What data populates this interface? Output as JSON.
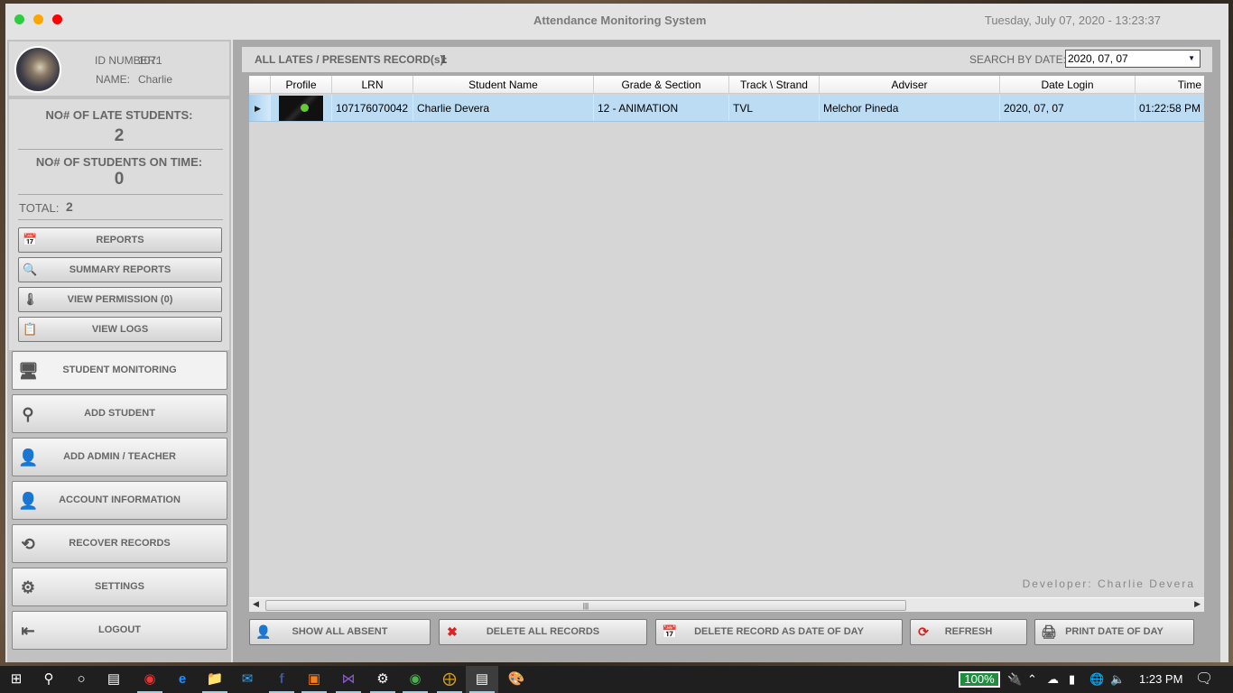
{
  "window": {
    "title": "Attendance Monitoring System",
    "datetime": "Tuesday, July  07, 2020 - 13:23:37",
    "controls": [
      {
        "name": "maximize",
        "color": "#2ecc40"
      },
      {
        "name": "minimize",
        "color": "#ffa500"
      },
      {
        "name": "close",
        "color": "#ff0000"
      }
    ]
  },
  "profile": {
    "id_label": "ID NUMBER:",
    "id_value": "1071",
    "name_label": "NAME:",
    "name_value": "Charlie"
  },
  "stats": {
    "late_label": "NO# OF LATE STUDENTS:",
    "late_value": "2",
    "ontime_label": "NO# OF STUDENTS ON TIME:",
    "ontime_value": "0",
    "total_label": "TOTAL:",
    "total_value": "2"
  },
  "side_buttons": [
    {
      "label": "REPORTS",
      "icon": "calendar-icon"
    },
    {
      "label": "SUMMARY REPORTS",
      "icon": "magnifier-chart-icon"
    },
    {
      "label": "VIEW PERMISSION (0)",
      "icon": "thermometer-icon"
    },
    {
      "label": "VIEW LOGS",
      "icon": "clipboard-icon"
    }
  ],
  "nav": [
    {
      "label": "STUDENT MONITORING",
      "icon": "monitor-icon",
      "active": true
    },
    {
      "label": "ADD STUDENT",
      "icon": "user-add-icon"
    },
    {
      "label": "ADD ADMIN / TEACHER",
      "icon": "user-icon"
    },
    {
      "label": "ACCOUNT INFORMATION",
      "icon": "user-info-icon"
    },
    {
      "label": "RECOVER RECORDS",
      "icon": "recover-icon"
    },
    {
      "label": "SETTINGS",
      "icon": "gear-icon"
    },
    {
      "label": "LOGOUT",
      "icon": "logout-icon"
    }
  ],
  "main": {
    "records_label": "ALL LATES / PRESENTS RECORD(s):",
    "records_count": "1",
    "search_label": "SEARCH BY DATE:",
    "search_value": "2020, 07, 07",
    "developer": "Developer: Charlie Devera"
  },
  "table": {
    "columns": [
      "Profile",
      "LRN",
      "Student Name",
      "Grade & Section",
      "Track \\ Strand",
      "Adviser",
      "Date Login",
      "Time"
    ],
    "rows": [
      {
        "profile": "android-thumbnail",
        "lrn": "107176070042",
        "name": "Charlie Devera",
        "grade": "12 - ANIMATION",
        "track": "TVL",
        "adviser": "Melchor Pineda",
        "date": "2020, 07, 07",
        "time": "01:22:58 PM"
      }
    ]
  },
  "bottom_buttons": [
    {
      "label": "SHOW ALL ABSENT",
      "icon": "user-clock-icon"
    },
    {
      "label": "DELETE ALL RECORDS",
      "icon": "delete-x-icon"
    },
    {
      "label": "DELETE RECORD AS DATE OF DAY",
      "icon": "calendar-delete-icon"
    },
    {
      "label": "REFRESH",
      "icon": "refresh-icon"
    },
    {
      "label": "PRINT DATE OF DAY",
      "icon": "printer-icon"
    }
  ],
  "taskbar": {
    "apps": [
      "start",
      "search",
      "cortana",
      "task-view",
      "vivaldi",
      "edge",
      "file-explorer",
      "mail",
      "facebook",
      "xampp",
      "visual-studio",
      "settings",
      "chrome",
      "target-app",
      "attendance-app",
      "paint"
    ],
    "battery": "100%",
    "time": "1:23 PM"
  }
}
